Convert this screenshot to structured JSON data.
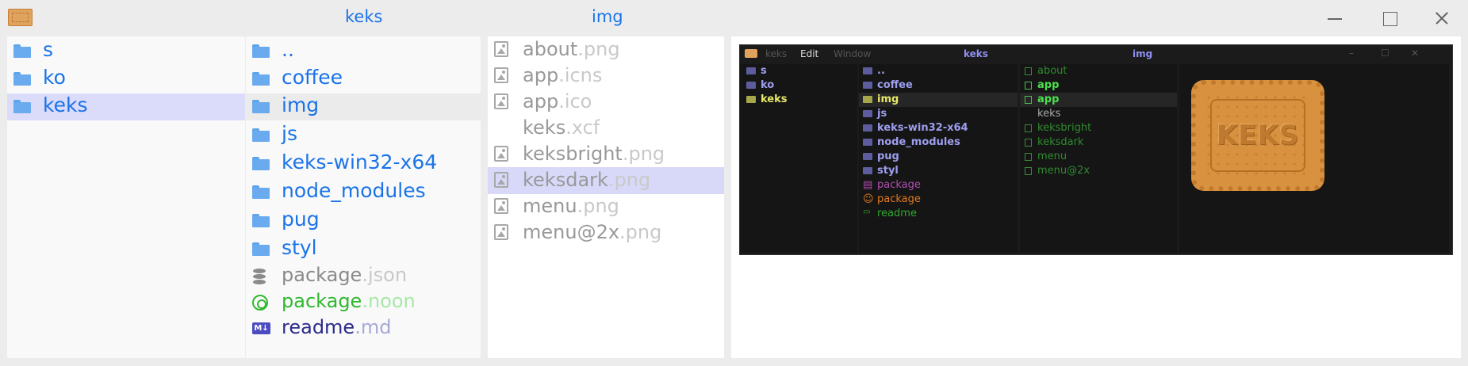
{
  "titlebar": {
    "crumbs": [
      "keks",
      "img"
    ]
  },
  "col1": {
    "items": [
      {
        "label": "s",
        "selected": false
      },
      {
        "label": "ko",
        "selected": false
      },
      {
        "label": "keks",
        "selected": true
      }
    ]
  },
  "col2": {
    "folders": [
      "..",
      "coffee",
      "img",
      "js",
      "keks-win32-x64",
      "node_modules",
      "pug",
      "styl"
    ],
    "files": [
      {
        "name": "package",
        "ext": ".json",
        "icon": "database-icon",
        "color": "#8a8a8a"
      },
      {
        "name": "package",
        "ext": ".noon",
        "icon": "smiley-icon",
        "color": "#2fb82f"
      },
      {
        "name": "readme",
        "ext": ".md",
        "icon": "markdown-icon",
        "color": "#2b2b8a"
      }
    ],
    "md_badge": "M↓"
  },
  "col3": {
    "files": [
      {
        "name": "about",
        "ext": ".png",
        "icon": true
      },
      {
        "name": "app",
        "ext": ".icns",
        "icon": true
      },
      {
        "name": "app",
        "ext": ".ico",
        "icon": true
      },
      {
        "name": "keks",
        "ext": ".xcf",
        "icon": false
      },
      {
        "name": "keksbright",
        "ext": ".png",
        "icon": true
      },
      {
        "name": "keksdark",
        "ext": ".png",
        "icon": true
      },
      {
        "name": "menu",
        "ext": ".png",
        "icon": true
      },
      {
        "name": "menu@2x",
        "ext": ".png",
        "icon": true
      }
    ]
  },
  "preview": {
    "title": {
      "app": "keks",
      "edit": "Edit",
      "window": "Window",
      "crumb1": "keks",
      "crumb2": "img"
    },
    "col1": [
      "s",
      "ko",
      "keks"
    ],
    "col2": [
      "..",
      "coffee",
      "img",
      "js",
      "keks-win32-x64",
      "node_modules",
      "pug",
      "styl",
      "package",
      "package",
      "readme"
    ],
    "col3": [
      "about",
      "app",
      "app",
      "keks",
      "keksbright",
      "keksdark",
      "menu",
      "menu@2x"
    ],
    "image_text": "KEKS"
  }
}
